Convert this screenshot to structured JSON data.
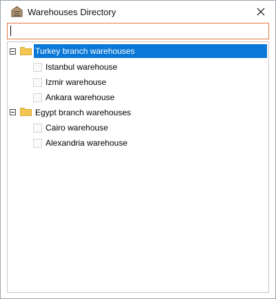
{
  "window": {
    "title": "Warehouses Directory",
    "icon": "warehouse-icon",
    "close_icon": "close-icon"
  },
  "search": {
    "value": "",
    "placeholder": ""
  },
  "tree": {
    "groups": [
      {
        "label": "Turkey branch warehouses",
        "expanded": true,
        "selected": true,
        "items": [
          "Istanbul warehouse",
          "Izmir warehouse",
          "Ankara warehouse"
        ]
      },
      {
        "label": "Egypt branch warehouses",
        "expanded": true,
        "selected": false,
        "items": [
          "Cairo warehouse",
          "Alexandria warehouse"
        ]
      }
    ]
  },
  "colors": {
    "selection": "#0a78d7",
    "folder": "#f3c653",
    "search_border": "#e07840"
  }
}
